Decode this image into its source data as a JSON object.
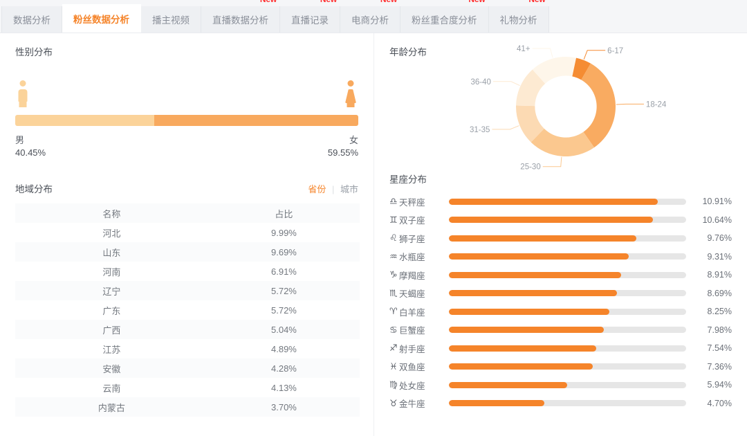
{
  "tabs": [
    {
      "label": "数据分析",
      "active": false,
      "badge": ""
    },
    {
      "label": "粉丝数据分析",
      "active": true,
      "badge": ""
    },
    {
      "label": "播主视频",
      "active": false,
      "badge": ""
    },
    {
      "label": "直播数据分析",
      "active": false,
      "badge": "New"
    },
    {
      "label": "直播记录",
      "active": false,
      "badge": "New"
    },
    {
      "label": "电商分析",
      "active": false,
      "badge": "New"
    },
    {
      "label": "粉丝重合度分析",
      "active": false,
      "badge": "New"
    },
    {
      "label": "礼物分析",
      "active": false,
      "badge": "New"
    }
  ],
  "gender": {
    "title": "性别分布",
    "male_label": "男",
    "male_pct_text": "40.45%",
    "female_label": "女",
    "female_pct_text": "59.55%",
    "male_color": "#fbd39a",
    "female_color": "#f8a95e"
  },
  "region": {
    "title": "地域分布",
    "toggle_province": "省份",
    "toggle_separator": "|",
    "toggle_city": "城市",
    "columns": [
      "名称",
      "占比"
    ],
    "rows": [
      {
        "name": "河北",
        "pct": "9.99%"
      },
      {
        "name": "山东",
        "pct": "9.69%"
      },
      {
        "name": "河南",
        "pct": "6.91%"
      },
      {
        "name": "辽宁",
        "pct": "5.72%"
      },
      {
        "name": "广东",
        "pct": "5.72%"
      },
      {
        "name": "广西",
        "pct": "5.04%"
      },
      {
        "name": "江苏",
        "pct": "4.89%"
      },
      {
        "name": "安徽",
        "pct": "4.28%"
      },
      {
        "name": "云南",
        "pct": "4.13%"
      },
      {
        "name": "内蒙古",
        "pct": "3.70%"
      }
    ]
  },
  "age": {
    "title": "年龄分布"
  },
  "zodiac": {
    "title": "星座分布",
    "bar_color": "#f5842a",
    "track_color": "#e6e6e6",
    "rows": [
      {
        "symbol": "♎",
        "name": "天秤座",
        "pct_text": "10.91%",
        "value": 10.91
      },
      {
        "symbol": "♊",
        "name": "双子座",
        "pct_text": "10.64%",
        "value": 10.64
      },
      {
        "symbol": "♌",
        "name": "狮子座",
        "pct_text": "9.76%",
        "value": 9.76
      },
      {
        "symbol": "♒",
        "name": "水瓶座",
        "pct_text": "9.31%",
        "value": 9.31
      },
      {
        "symbol": "♑",
        "name": "摩羯座",
        "pct_text": "8.91%",
        "value": 8.91
      },
      {
        "symbol": "♏",
        "name": "天蝎座",
        "pct_text": "8.69%",
        "value": 8.69
      },
      {
        "symbol": "♈",
        "name": "白羊座",
        "pct_text": "8.25%",
        "value": 8.25
      },
      {
        "symbol": "♋",
        "name": "巨蟹座",
        "pct_text": "7.98%",
        "value": 7.98
      },
      {
        "symbol": "♐",
        "name": "射手座",
        "pct_text": "7.54%",
        "value": 7.54
      },
      {
        "symbol": "♓",
        "name": "双鱼座",
        "pct_text": "7.36%",
        "value": 7.36
      },
      {
        "symbol": "♍",
        "name": "处女座",
        "pct_text": "5.94%",
        "value": 5.94
      },
      {
        "symbol": "♉",
        "name": "金牛座",
        "pct_text": "4.70%",
        "value": 4.7
      }
    ]
  },
  "chart_data": [
    {
      "type": "bar",
      "title": "性别分布",
      "categories": [
        "男",
        "女"
      ],
      "values": [
        40.45,
        59.55
      ],
      "unit": "%",
      "orientation": "horizontal-stacked",
      "colors": [
        "#fbd39a",
        "#f8a95e"
      ],
      "xlabel": "",
      "ylabel": "",
      "legend": "none",
      "grid": false
    },
    {
      "type": "table",
      "title": "地域分布",
      "columns": [
        "名称",
        "占比"
      ],
      "rows": [
        [
          "河北",
          "9.99%"
        ],
        [
          "山东",
          "9.69%"
        ],
        [
          "河南",
          "6.91%"
        ],
        [
          "辽宁",
          "5.72%"
        ],
        [
          "广东",
          "5.72%"
        ],
        [
          "广西",
          "5.04%"
        ],
        [
          "江苏",
          "4.89%"
        ],
        [
          "安徽",
          "4.28%"
        ],
        [
          "云南",
          "4.13%"
        ],
        [
          "内蒙古",
          "3.70%"
        ]
      ]
    },
    {
      "type": "pie",
      "subtype": "donut",
      "title": "年龄分布",
      "labels": [
        "6-17",
        "18-24",
        "25-30",
        "31-35",
        "36-40",
        "41+"
      ],
      "values": [
        5,
        32,
        22,
        13,
        13,
        15
      ],
      "unit": "%",
      "colors": [
        "#f58c33",
        "#f9ab61",
        "#fbc88f",
        "#fcdab3",
        "#fdead2",
        "#fef6ea"
      ],
      "legend": "outside-labels-with-leader-lines",
      "start_angle_deg": 12,
      "inner_radius_ratio": 0.62
    },
    {
      "type": "bar",
      "title": "星座分布",
      "orientation": "horizontal",
      "categories": [
        "天秤座",
        "双子座",
        "狮子座",
        "水瓶座",
        "摩羯座",
        "天蝎座",
        "白羊座",
        "巨蟹座",
        "射手座",
        "双鱼座",
        "处女座",
        "金牛座"
      ],
      "values": [
        10.91,
        10.64,
        9.76,
        9.31,
        8.91,
        8.69,
        8.25,
        7.98,
        7.54,
        7.36,
        5.94,
        4.7
      ],
      "unit": "%",
      "xlabel": "",
      "ylabel": "",
      "xlim": [
        0,
        12
      ],
      "grid": false,
      "legend": "none",
      "bar_color": "#f5842a",
      "track_color": "#e6e6e6"
    }
  ]
}
